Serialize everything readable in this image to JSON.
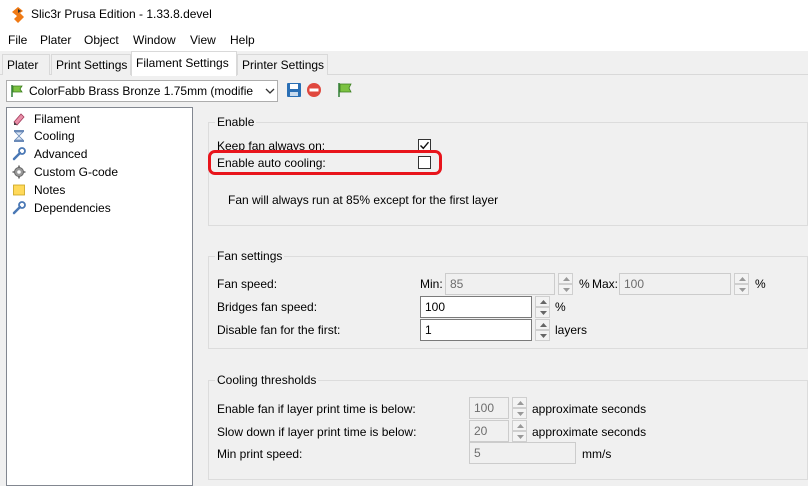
{
  "window": {
    "title": "Slic3r Prusa Edition - 1.33.8.devel"
  },
  "menu": [
    "File",
    "Plater",
    "Object",
    "Window",
    "View",
    "Help"
  ],
  "tabs": [
    "Plater",
    "Print Settings",
    "Filament Settings",
    "Printer Settings"
  ],
  "active_tab": "Filament Settings",
  "preset": {
    "selected": "ColorFabb Brass Bronze 1.75mm (modifie"
  },
  "toolbar": {
    "save_icon": "save-icon",
    "delete_icon": "delete-icon",
    "compare_icon": "flag-icon"
  },
  "tree": {
    "items": [
      {
        "label": "Filament",
        "icon": "spool-icon"
      },
      {
        "label": "Cooling",
        "icon": "hourglass-icon"
      },
      {
        "label": "Advanced",
        "icon": "wrench-icon"
      },
      {
        "label": "Custom G-code",
        "icon": "gear-icon"
      },
      {
        "label": "Notes",
        "icon": "note-icon"
      },
      {
        "label": "Dependencies",
        "icon": "wrench-icon"
      }
    ],
    "selected": "Cooling"
  },
  "enable_group": {
    "title": "Enable",
    "keep_fan_label": "Keep fan always on:",
    "keep_fan_checked": true,
    "auto_cooling_label": "Enable auto cooling:",
    "auto_cooling_checked": false,
    "description": "Fan will always run at 85% except for the first layer"
  },
  "fan_group": {
    "title": "Fan settings",
    "fan_speed_label": "Fan speed:",
    "min_label": "Min:",
    "min_value": "85",
    "min_unit": "%",
    "max_label": "Max:",
    "max_value": "100",
    "max_unit": "%",
    "bridges_label": "Bridges fan speed:",
    "bridges_value": "100",
    "bridges_unit": "%",
    "disable_first_label": "Disable fan for the first:",
    "disable_first_value": "1",
    "disable_first_unit": "layers"
  },
  "thresholds_group": {
    "title": "Cooling thresholds",
    "enable_fan_label": "Enable fan if layer print time is below:",
    "enable_fan_value": "100",
    "enable_fan_unit": "approximate seconds",
    "slow_down_label": "Slow down if layer print time is below:",
    "slow_down_value": "20",
    "slow_down_unit": "approximate seconds",
    "min_speed_label": "Min print speed:",
    "min_speed_value": "5",
    "min_speed_unit": "mm/s"
  },
  "annotation": {
    "highlight_color": "#e8141b"
  }
}
